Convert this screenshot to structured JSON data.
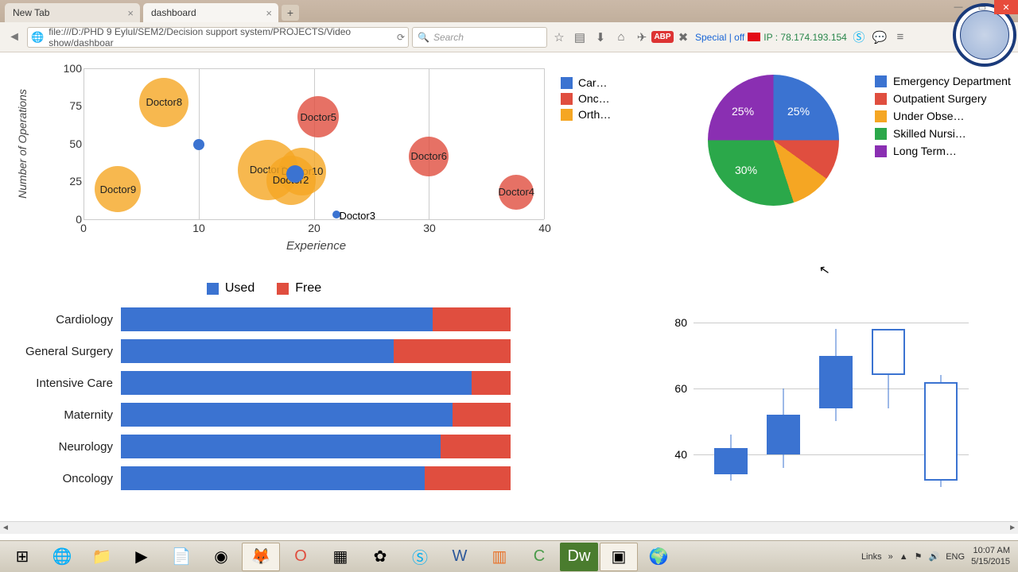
{
  "browser": {
    "tabs": [
      {
        "title": "New Tab",
        "active": false
      },
      {
        "title": "dashboard",
        "active": true
      }
    ],
    "url": "file:///D:/PHD 9 Eylul/SEM2/Decision support system/PROJECTS/Video show/dashboar",
    "search_placeholder": "Search",
    "special_text": "Special | off",
    "ip_label": "IP :",
    "ip_value": "78.174.193.154"
  },
  "chart_data": [
    {
      "type": "scatter",
      "title": "",
      "xlabel": "Experience",
      "ylabel": "Number of Operations",
      "xlim": [
        0,
        40
      ],
      "ylim": [
        0,
        100
      ],
      "x_ticks": [
        0,
        10,
        20,
        30,
        40
      ],
      "y_ticks": [
        0,
        25,
        50,
        75,
        100
      ],
      "series": [
        {
          "name": "Car…",
          "color": "#3b73d1",
          "points": [
            {
              "label": "",
              "x": 10,
              "y": 50,
              "size": 12
            },
            {
              "label": "",
              "x": 18,
              "y": 30,
              "size": 18
            },
            {
              "label": "Doctor3",
              "x": 22,
              "y": 3,
              "size": 8
            }
          ]
        },
        {
          "name": "Onc…",
          "color": "#e04e3f",
          "points": [
            {
              "label": "Doctor5",
              "x": 20.5,
              "y": 68,
              "size": 32
            },
            {
              "label": "Doctor6",
              "x": 30,
              "y": 42,
              "size": 30
            },
            {
              "label": "Doctor4",
              "x": 37.5,
              "y": 18,
              "size": 26
            }
          ]
        },
        {
          "name": "Orth…",
          "color": "#f5a623",
          "points": [
            {
              "label": "Doctor8",
              "x": 7,
              "y": 78,
              "size": 38
            },
            {
              "label": "Doctor9",
              "x": 3,
              "y": 20,
              "size": 36
            },
            {
              "label": "Doctor7",
              "x": 16,
              "y": 33,
              "size": 46
            },
            {
              "label": "Doctor10",
              "x": 19,
              "y": 32,
              "size": 36
            },
            {
              "label": "Doctor2",
              "x": 18,
              "y": 26,
              "size": 38
            }
          ]
        }
      ]
    },
    {
      "type": "pie",
      "slices": [
        {
          "label": "Emergency Department",
          "value": 25,
          "color": "#3b73d1",
          "text": "25%"
        },
        {
          "label": "Outpatient Surgery",
          "value": 10,
          "color": "#e04e3f",
          "text": ""
        },
        {
          "label": "Under Obse…",
          "value": 10,
          "color": "#f5a623",
          "text": ""
        },
        {
          "label": "Skilled Nursi…",
          "value": 30,
          "color": "#2ba84a",
          "text": "30%"
        },
        {
          "label": "Long Term…",
          "value": 25,
          "color": "#8a2fb2",
          "text": "25%"
        }
      ]
    },
    {
      "type": "bar",
      "orientation": "horizontal",
      "stacked": true,
      "series_names": [
        "Used",
        "Free"
      ],
      "series_colors": [
        "#3b73d1",
        "#e04e3f"
      ],
      "categories": [
        "Cardiology",
        "General Surgery",
        "Intensive Care",
        "Maternity",
        "Neurology",
        "Oncology"
      ],
      "series": [
        {
          "name": "Used",
          "values": [
            80,
            70,
            90,
            85,
            82,
            78
          ]
        },
        {
          "name": "Free",
          "values": [
            20,
            30,
            10,
            15,
            18,
            22
          ]
        }
      ]
    },
    {
      "type": "candlestick",
      "ylim": [
        20,
        80
      ],
      "y_ticks": [
        40,
        60,
        80
      ],
      "points": [
        {
          "open": 42,
          "close": 34,
          "high": 46,
          "low": 32,
          "filled": true
        },
        {
          "open": 52,
          "close": 40,
          "high": 60,
          "low": 36,
          "filled": true
        },
        {
          "open": 70,
          "close": 54,
          "high": 78,
          "low": 50,
          "filled": true
        },
        {
          "open": 64,
          "close": 78,
          "high": 78,
          "low": 54,
          "filled": false
        },
        {
          "open": 32,
          "close": 62,
          "high": 64,
          "low": 30,
          "filled": false
        }
      ]
    }
  ],
  "taskbar": {
    "tray": {
      "links": "Links",
      "lang": "ENG",
      "time": "10:07 AM",
      "date": "5/15/2015"
    }
  }
}
